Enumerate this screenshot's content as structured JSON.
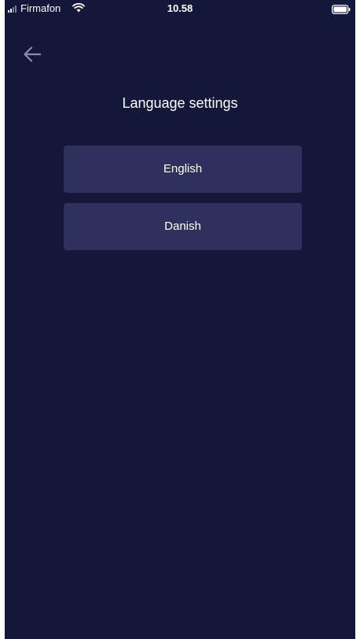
{
  "status_bar": {
    "carrier": "Firmafon",
    "time": "10.58",
    "signal_icon": "signal-bars-icon",
    "wifi_icon": "wifi-icon",
    "battery_icon": "battery-icon"
  },
  "header": {
    "back_icon": "arrow-left-icon",
    "title": "Language settings"
  },
  "languages": {
    "options": [
      {
        "label": "English"
      },
      {
        "label": "Danish"
      }
    ]
  },
  "colors": {
    "background": "#131739",
    "option_background": "#2f315c",
    "text": "#ffffff",
    "back_icon": "#8a8ca4"
  }
}
